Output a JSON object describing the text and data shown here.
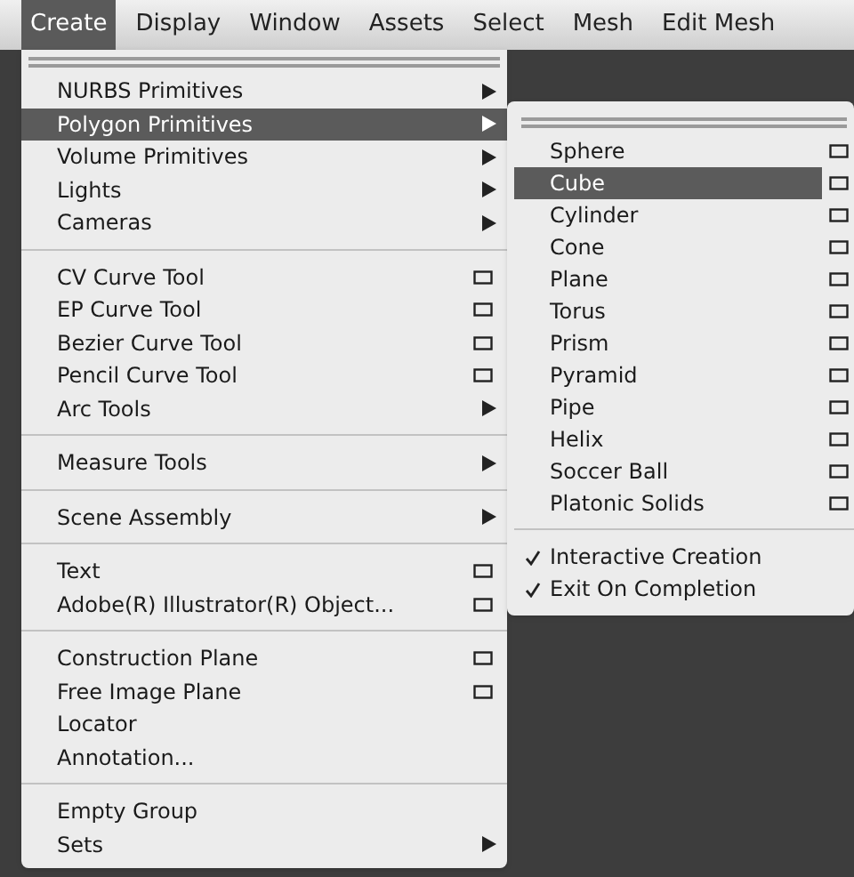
{
  "menubar": [
    {
      "label": "Create",
      "selected": true
    },
    {
      "label": "Display",
      "selected": false
    },
    {
      "label": "Window",
      "selected": false
    },
    {
      "label": "Assets",
      "selected": false
    },
    {
      "label": "Select",
      "selected": false
    },
    {
      "label": "Mesh",
      "selected": false
    },
    {
      "label": "Edit Mesh",
      "selected": false
    }
  ],
  "menu": {
    "groups": [
      [
        {
          "label": "NURBS Primitives",
          "kind": "submenu",
          "selected": false
        },
        {
          "label": "Polygon Primitives",
          "kind": "submenu",
          "selected": true
        },
        {
          "label": "Volume Primitives",
          "kind": "submenu",
          "selected": false
        },
        {
          "label": "Lights",
          "kind": "submenu",
          "selected": false
        },
        {
          "label": "Cameras",
          "kind": "submenu",
          "selected": false
        }
      ],
      [
        {
          "label": "CV Curve Tool",
          "kind": "option",
          "selected": false
        },
        {
          "label": "EP Curve Tool",
          "kind": "option",
          "selected": false
        },
        {
          "label": "Bezier Curve Tool",
          "kind": "option",
          "selected": false
        },
        {
          "label": "Pencil Curve Tool",
          "kind": "option",
          "selected": false
        },
        {
          "label": "Arc Tools",
          "kind": "submenu",
          "selected": false
        }
      ],
      [
        {
          "label": "Measure Tools",
          "kind": "submenu",
          "selected": false
        }
      ],
      [
        {
          "label": "Scene Assembly",
          "kind": "submenu",
          "selected": false
        }
      ],
      [
        {
          "label": "Text",
          "kind": "option",
          "selected": false
        },
        {
          "label": "Adobe(R) Illustrator(R) Object...",
          "kind": "option",
          "selected": false
        }
      ],
      [
        {
          "label": "Construction Plane",
          "kind": "option",
          "selected": false
        },
        {
          "label": "Free Image Plane",
          "kind": "option",
          "selected": false
        },
        {
          "label": "Locator",
          "kind": "plain",
          "selected": false
        },
        {
          "label": "Annotation...",
          "kind": "plain",
          "selected": false
        }
      ],
      [
        {
          "label": "Empty Group",
          "kind": "plain",
          "selected": false
        },
        {
          "label": "Sets",
          "kind": "submenu",
          "selected": false
        }
      ]
    ]
  },
  "submenu": {
    "groups": [
      [
        {
          "label": "Sphere",
          "kind": "option",
          "selected": false
        },
        {
          "label": "Cube",
          "kind": "option",
          "selected": true
        },
        {
          "label": "Cylinder",
          "kind": "option",
          "selected": false
        },
        {
          "label": "Cone",
          "kind": "option",
          "selected": false
        },
        {
          "label": "Plane",
          "kind": "option",
          "selected": false
        },
        {
          "label": "Torus",
          "kind": "option",
          "selected": false
        },
        {
          "label": "Prism",
          "kind": "option",
          "selected": false
        },
        {
          "label": "Pyramid",
          "kind": "option",
          "selected": false
        },
        {
          "label": "Pipe",
          "kind": "option",
          "selected": false
        },
        {
          "label": "Helix",
          "kind": "option",
          "selected": false
        },
        {
          "label": "Soccer Ball",
          "kind": "option",
          "selected": false
        },
        {
          "label": "Platonic Solids",
          "kind": "option",
          "selected": false
        }
      ],
      [
        {
          "label": "Interactive Creation",
          "kind": "check",
          "checked": true,
          "selected": false
        },
        {
          "label": "Exit On Completion",
          "kind": "check",
          "checked": true,
          "selected": false
        }
      ]
    ]
  }
}
